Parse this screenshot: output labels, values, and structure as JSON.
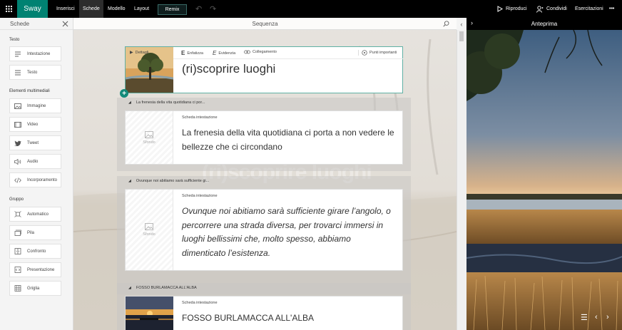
{
  "app": {
    "name": "Sway"
  },
  "menu": {
    "insert": "Inserisci",
    "cards": "Schede",
    "design": "Modello",
    "layout": "Layout",
    "remix": "Remix"
  },
  "actions": {
    "play": "Riproduci",
    "share": "Condividi",
    "tutorials": "Esercitazioni",
    "more": "•••"
  },
  "cards_panel": {
    "title": "Schede",
    "sections": [
      {
        "label": "Testo",
        "items": [
          "Intestazione",
          "Testo"
        ]
      },
      {
        "label": "Elementi multimediali",
        "items": [
          "Immagine",
          "Video",
          "Tweet",
          "Audio",
          "Incorporamento"
        ]
      },
      {
        "label": "Gruppo",
        "items": [
          "Automatico",
          "Pila",
          "Confronto",
          "Presentazione",
          "Griglia"
        ]
      }
    ]
  },
  "storyline": {
    "header": "Sequenza",
    "watermark": "(ri)scoprire luoghi",
    "title_card": {
      "details": "Dettagli",
      "emphasis": "Enfatizza",
      "highlight": "Evidenzia",
      "link": "Collegamento",
      "focus_points": "Punti importanti",
      "title": "(ri)scoprire luoghi"
    },
    "groups": [
      {
        "title": "La frenesia della vita quotidiana ci por...",
        "type": "Scheda intestazione",
        "placeholder": "Sfondo",
        "text": "La frenesia della vita quotidiana ci porta a non vedere le bellezze che ci circondano"
      },
      {
        "title": "Ovunque noi abitiamo sarà sufficiente gi...",
        "type": "Scheda intestazione",
        "placeholder": "Sfondo",
        "text": "Ovunque noi abitiamo sarà sufficiente girare l’angolo, o percorrere una strada diversa, per trovarci immersi in luoghi bellissimi che, molto spesso, abbiamo dimenticato l’esistenza."
      },
      {
        "title": "FOSSO BURLAMACCA ALL'ALBA",
        "type": "Scheda intestazione",
        "text": "FOSSO BURLAMACCA ALL'ALBA"
      }
    ]
  },
  "preview": {
    "title": "Anteprima"
  },
  "colors": {
    "accent": "#008272",
    "topbar": "#000000",
    "panel": "#f4f4f4"
  }
}
